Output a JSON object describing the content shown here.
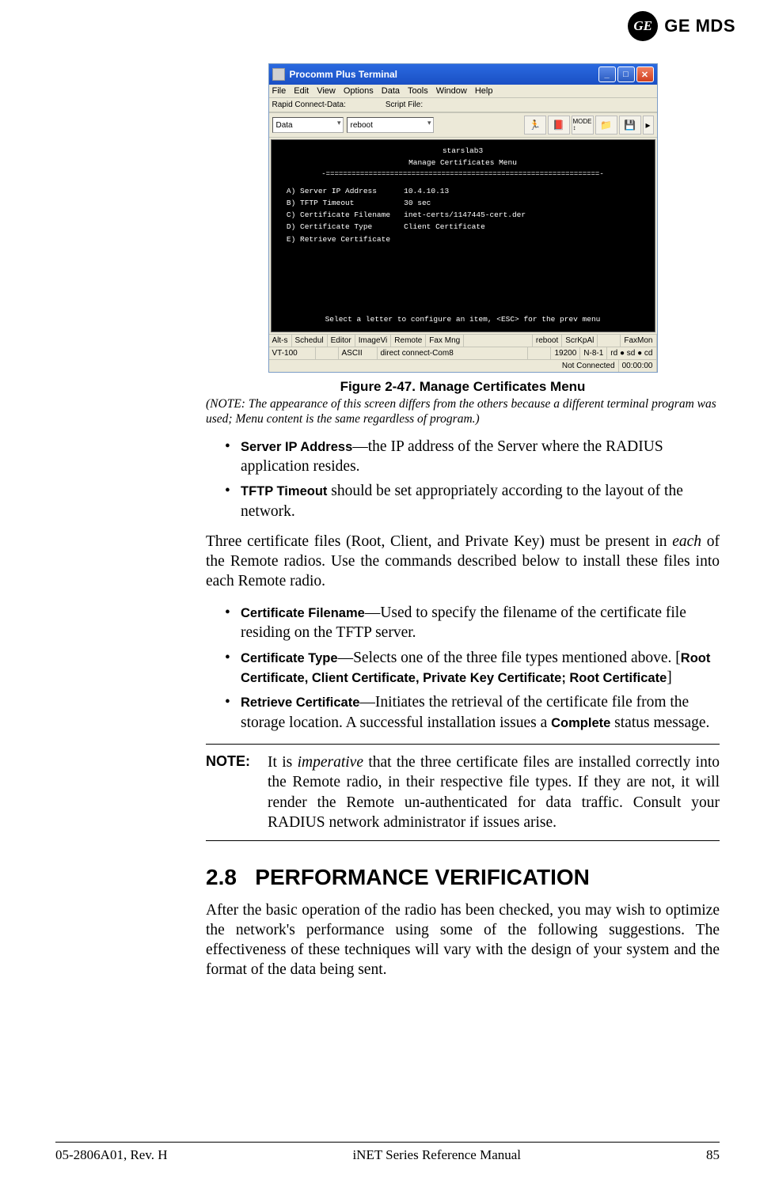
{
  "logo": {
    "monogram": "GE",
    "brand": "GE MDS"
  },
  "window": {
    "title": "Procomm Plus Terminal",
    "menu": [
      "File",
      "Edit",
      "View",
      "Options",
      "Data",
      "Tools",
      "Window",
      "Help"
    ],
    "toolbar": {
      "rapid_label": "Rapid Connect-Data:",
      "rapid_value": "Data",
      "script_label": "Script File:",
      "script_value": "reboot"
    },
    "terminal": {
      "host": "starslab3",
      "heading": "Manage Certificates Menu",
      "items": [
        {
          "key": "A)",
          "label": "Server IP Address",
          "value": "10.4.10.13"
        },
        {
          "key": "B)",
          "label": "TFTP Timeout",
          "value": "30 sec"
        },
        {
          "key": "C)",
          "label": "Certificate Filename",
          "value": "inet-certs/1147445-cert.der"
        },
        {
          "key": "D)",
          "label": "Certificate Type",
          "value": "Client Certificate"
        },
        {
          "key": "E)",
          "label": "Retrieve Certificate",
          "value": ""
        }
      ],
      "footer": "Select a letter to configure an item, <ESC> for the prev menu"
    },
    "tabs1": [
      "Alt-s",
      "Schedul",
      "Editor",
      "ImageVi",
      "Remote",
      "Fax Mng",
      "",
      "reboot",
      "ScrKpAl",
      "",
      "FaxMon"
    ],
    "status1": [
      "VT-100",
      "",
      "ASCII",
      "direct connect-Com8",
      "",
      "19200",
      "N-8-1",
      "rd ●  sd ●  cd"
    ],
    "status2": [
      "Not Connected",
      "00:00:00"
    ]
  },
  "figure": {
    "caption": "Figure 2-47. Manage Certificates Menu",
    "note": "(NOTE: The appearance of this screen differs from the others because a different terminal program was used; Menu content is the same regardless of program.)"
  },
  "bullets1": [
    {
      "term": "Server IP Address",
      "text": "—the IP address of the Server where the RADIUS application resides."
    },
    {
      "term": "TFTP Timeout",
      "text": " should be set appropriately according to the layout of the network."
    }
  ],
  "para1": "Three certificate files (Root, Client, and Private Key) must be present in each of the Remote radios. Use the commands described below to install these files into each Remote radio.",
  "bullets2": [
    {
      "term": "Certificate Filename",
      "text": "—Used to specify the filename of the certificate file residing on the TFTP server."
    },
    {
      "term": "Certificate Type",
      "text": "—Selects one of the three file types mentioned above. [",
      "opts": "Root Certificate, Client Certificate, Private Key Certificate; Root Certificate",
      "tail": "]"
    },
    {
      "term": "Retrieve Certificate",
      "text": "—Initiates the retrieval of the certificate file from the storage location. A successful installation issues a ",
      "status": "Complete",
      "tail2": " status message."
    }
  ],
  "note": {
    "label": "NOTE:",
    "text": "It is imperative that the three certificate files are installed correctly into the Remote radio, in their respective file types. If they are not, it will render the Remote un-authenticated for data traffic. Consult your RADIUS network administrator if issues arise."
  },
  "section": {
    "number": "2.8",
    "title": "PERFORMANCE VERIFICATION"
  },
  "para2": "After the basic operation of the radio has been checked, you may wish to optimize the network's performance using some of the following suggestions. The effectiveness of these techniques will vary with the design of your system and the format of the data being sent.",
  "footer": {
    "left": "05-2806A01, Rev. H",
    "center": "iNET Series Reference Manual",
    "right": "85"
  }
}
